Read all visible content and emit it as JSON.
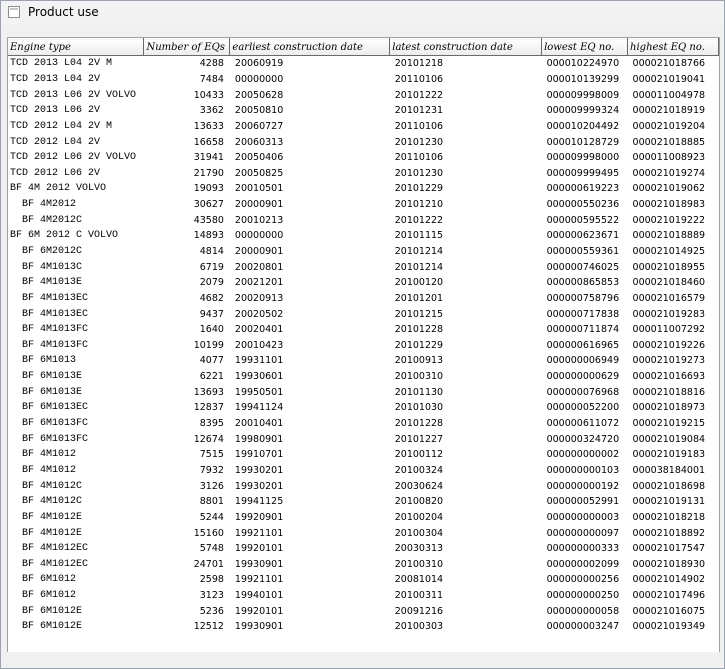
{
  "window": {
    "title": "Product use",
    "icon": "window-app-icon"
  },
  "table": {
    "columns": [
      "Engine type",
      "Number of EQs",
      "earliest construction date",
      "latest construction date",
      "lowest EQ no.",
      "highest EQ no."
    ],
    "rows": [
      [
        "TCD 2013 L04 2V M",
        "4288",
        "20060919",
        "20101218",
        "000010224970",
        "000021018766"
      ],
      [
        "TCD 2013 L04 2V",
        "7484",
        "00000000",
        "20110106",
        "000010139299",
        "000021019041"
      ],
      [
        "TCD 2013 L06 2V VOLVO",
        "10433",
        "20050628",
        "20101222",
        "000009998009",
        "000011004978"
      ],
      [
        "TCD 2013 L06 2V",
        "3362",
        "20050810",
        "20101231",
        "000009999324",
        "000021018919"
      ],
      [
        "TCD 2012 L04 2V M",
        "13633",
        "20060727",
        "20110106",
        "000010204492",
        "000021019204"
      ],
      [
        "TCD 2012 L04 2V",
        "16658",
        "20060313",
        "20101230",
        "000010128729",
        "000021018885"
      ],
      [
        "TCD 2012 L06 2V VOLVO",
        "31941",
        "20050406",
        "20110106",
        "000009998000",
        "000011008923"
      ],
      [
        "TCD 2012 L06 2V",
        "21790",
        "20050825",
        "20101230",
        "000009999495",
        "000021019274"
      ],
      [
        "BF 4M 2012 VOLVO",
        "19093",
        "20010501",
        "20101229",
        "000000619223",
        "000021019062"
      ],
      [
        "  BF 4M2012",
        "30627",
        "20000901",
        "20101210",
        "000000550236",
        "000021018983"
      ],
      [
        "  BF 4M2012C",
        "43580",
        "20010213",
        "20101222",
        "000000595522",
        "000021019222"
      ],
      [
        "BF 6M 2012 C VOLVO",
        "14893",
        "00000000",
        "20101115",
        "000000623671",
        "000021018889"
      ],
      [
        "  BF 6M2012C",
        "4814",
        "20000901",
        "20101214",
        "000000559361",
        "000021014925"
      ],
      [
        "  BF 4M1013C",
        "6719",
        "20020801",
        "20101214",
        "000000746025",
        "000021018955"
      ],
      [
        "  BF 4M1013E",
        "2079",
        "20021201",
        "20100120",
        "000000865853",
        "000021018460"
      ],
      [
        "  BF 4M1013EC",
        "4682",
        "20020913",
        "20101201",
        "000000758796",
        "000021016579"
      ],
      [
        "  BF 4M1013EC",
        "9437",
        "20020502",
        "20101215",
        "000000717838",
        "000021019283"
      ],
      [
        "  BF 4M1013FC",
        "1640",
        "20020401",
        "20101228",
        "000000711874",
        "000011007292"
      ],
      [
        "  BF 4M1013FC",
        "10199",
        "20010423",
        "20101229",
        "000000616965",
        "000021019226"
      ],
      [
        "  BF 6M1013",
        "4077",
        "19931101",
        "20100913",
        "000000006949",
        "000021019273"
      ],
      [
        "  BF 6M1013E",
        "6221",
        "19930601",
        "20100310",
        "000000000629",
        "000021016693"
      ],
      [
        "  BF 6M1013E",
        "13693",
        "19950501",
        "20101130",
        "000000076968",
        "000021018816"
      ],
      [
        "  BF 6M1013EC",
        "12837",
        "19941124",
        "20101030",
        "000000052200",
        "000021018973"
      ],
      [
        "  BF 6M1013FC",
        "8395",
        "20010401",
        "20101228",
        "000000611072",
        "000021019215"
      ],
      [
        "  BF 6M1013FC",
        "12674",
        "19980901",
        "20101227",
        "000000324720",
        "000021019084"
      ],
      [
        "  BF 4M1012",
        "7515",
        "19910701",
        "20100112",
        "000000000002",
        "000021019183"
      ],
      [
        "  BF 4M1012",
        "7932",
        "19930201",
        "20100324",
        "000000000103",
        "000038184001"
      ],
      [
        "  BF 4M1012C",
        "3126",
        "19930201",
        "20030624",
        "000000000192",
        "000021018698"
      ],
      [
        "  BF 4M1012C",
        "8801",
        "19941125",
        "20100820",
        "000000052991",
        "000021019131"
      ],
      [
        "  BF 4M1012E",
        "5244",
        "19920901",
        "20100204",
        "000000000003",
        "000021018218"
      ],
      [
        "  BF 4M1012E",
        "15160",
        "19921101",
        "20100304",
        "000000000097",
        "000021018892"
      ],
      [
        "  BF 4M1012EC",
        "5748",
        "19920101",
        "20030313",
        "000000000333",
        "000021017547"
      ],
      [
        "  BF 4M1012EC",
        "24701",
        "19930901",
        "20100310",
        "000000002099",
        "000021018930"
      ],
      [
        "  BF 6M1012",
        "2598",
        "19921101",
        "20081014",
        "000000000256",
        "000021014902"
      ],
      [
        "  BF 6M1012",
        "3123",
        "19940101",
        "20100311",
        "000000000250",
        "000021017496"
      ],
      [
        "  BF 6M1012E",
        "5236",
        "19920101",
        "20091216",
        "000000000058",
        "000021016075"
      ],
      [
        "  BF 6M1012E",
        "12512",
        "19930901",
        "20100303",
        "000000003247",
        "000021019349"
      ]
    ]
  }
}
